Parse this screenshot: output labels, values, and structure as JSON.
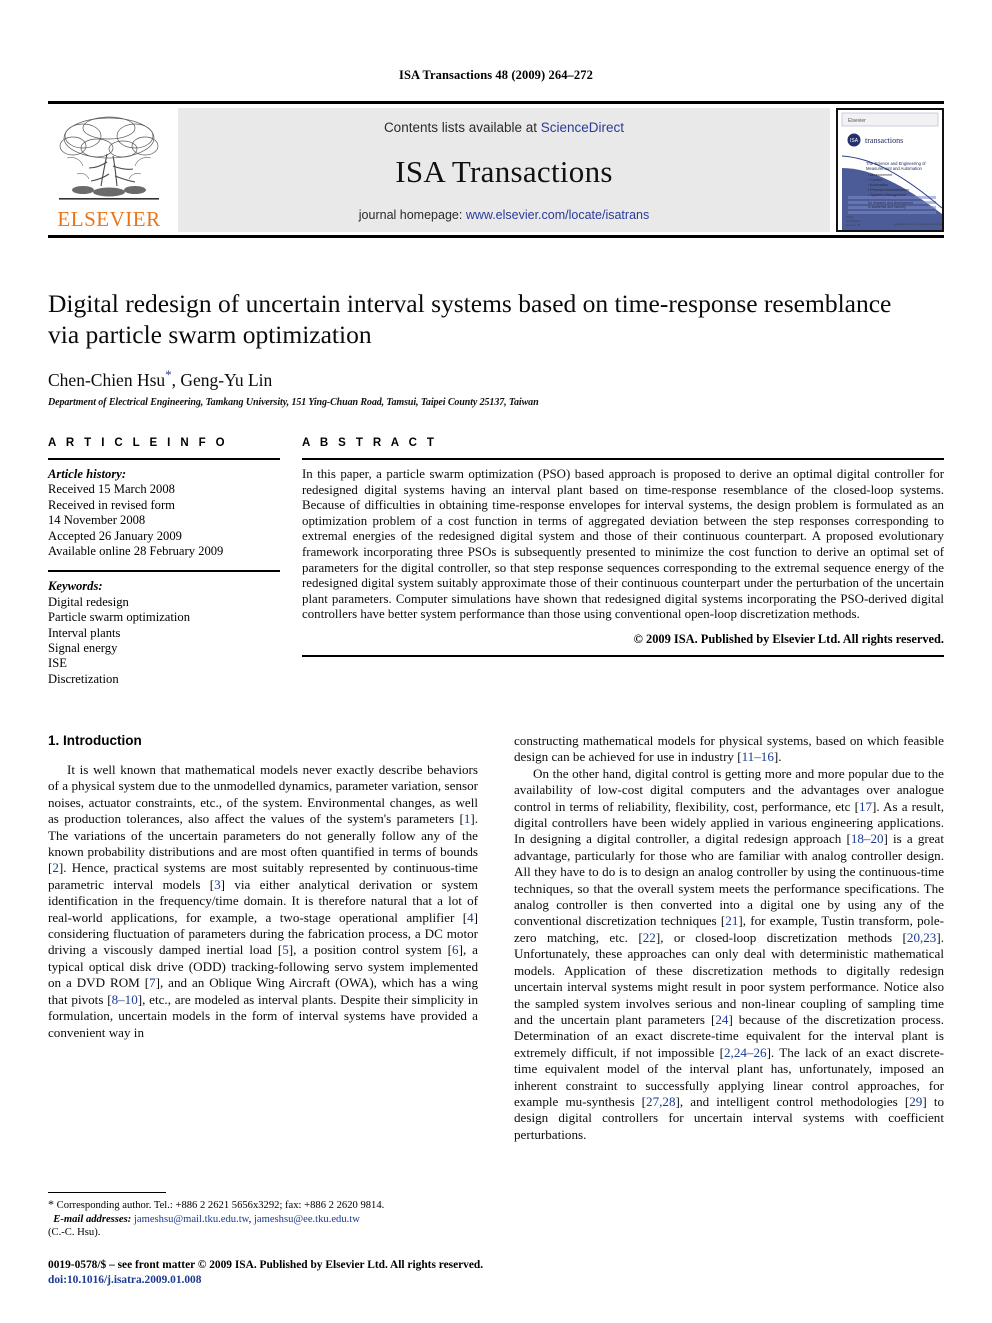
{
  "running_head": "ISA Transactions 48 (2009) 264–272",
  "masthead": {
    "publisher_name": "ELSEVIER",
    "publisher_logo_alt": "elsevier-tree-logo",
    "contents_prefix": "Contents lists available at ",
    "contents_link": "ScienceDirect",
    "journal_name": "ISA Transactions",
    "homepage_prefix": "journal homepage: ",
    "homepage_link": "www.elsevier.com/locate/isatrans",
    "cover_alt": "isa-transactions-journal-cover",
    "cover_masthead": "ISA",
    "cover_title": "transactions",
    "cover_subtitle": "The Science and Engineering of Measurement and Automation",
    "cover_bullets": [
      "Measurement",
      "Control",
      "Automation",
      "Process Instrumentation",
      "Systems Management"
    ],
    "cover_tagline": "for research and development in academia and industry"
  },
  "title": "Digital redesign of uncertain interval systems based on time-response resemblance via particle swarm optimization",
  "authors_text": "Chen-Chien Hsu",
  "authors_star": "*",
  "authors_rest": ", Geng-Yu Lin",
  "affiliation": "Department of Electrical Engineering, Tamkang University, 151 Ying-Chuan Road, Tamsui, Taipei County 25137, Taiwan",
  "article_info": {
    "heading": "A R T I C L E   I N F O",
    "history_label": "Article history:",
    "history": [
      "Received 15 March 2008",
      "Received in revised form",
      "14 November 2008",
      "Accepted 26 January 2009",
      "Available online 28 February 2009"
    ],
    "keywords_label": "Keywords:",
    "keywords": [
      "Digital redesign",
      "Particle swarm optimization",
      "Interval plants",
      "Signal energy",
      "ISE",
      "Discretization"
    ]
  },
  "abstract": {
    "heading": "A B S T R A C T",
    "body": "In this paper, a particle swarm optimization (PSO) based approach is proposed to derive an optimal digital controller for redesigned digital systems having an interval plant based on time-response resemblance of the closed-loop systems. Because of difficulties in obtaining time-response envelopes for interval systems, the design problem is formulated as an optimization problem of a cost function in terms of aggregated deviation between the step responses corresponding to extremal energies of the redesigned digital system and those of their continuous counterpart. A proposed evolutionary framework incorporating three PSOs is subsequently presented to minimize the cost function to derive an optimal set of parameters for the digital controller, so that step response sequences corresponding to the extremal sequence energy of the redesigned digital system suitably approximate those of their continuous counterpart under the perturbation of the uncertain plant parameters. Computer simulations have shown that redesigned digital systems incorporating the PSO-derived digital controllers have better system performance than those using conventional open-loop discretization methods.",
    "copyright": "© 2009 ISA. Published by Elsevier Ltd. All rights reserved."
  },
  "section": {
    "number_title": "1. Introduction"
  },
  "body_left": {
    "para1_html": "It is well known that mathematical models never exactly describe behaviors of a physical system due to the unmodelled dynamics, parameter variation, sensor noises, actuator constraints, etc., of the system. Environmental changes, as well as production tolerances, also affect the values of the system's parameters [1]. The variations of the uncertain parameters do not generally follow any of the known probability distributions and are most often quantified in terms of bounds [2]. Hence, practical systems are most suitably represented by continuous-time parametric interval models [3] via either analytical derivation or system identification in the frequency/time domain. It is therefore natural that a lot of real-world applications, for example, a two-stage operational amplifier [4] considering fluctuation of parameters during the fabrication process, a DC motor driving a viscously damped inertial load [5], a position control system [6], a typical optical disk drive (ODD) tracking-following servo system implemented on a DVD ROM [7], and an Oblique Wing Aircraft (OWA), which has a wing that pivots [8–10], etc., are modeled as interval plants. Despite their simplicity in formulation, uncertain models in the form of interval systems have provided a convenient way in"
  },
  "body_right": {
    "para_cont": "constructing mathematical models for physical systems, based on which feasible design can be achieved for use in industry [11–16].",
    "para2": "On the other hand, digital control is getting more and more popular due to the availability of low-cost digital computers and the advantages over analogue control in terms of reliability, flexibility, cost, performance, etc [17]. As a result, digital controllers have been widely applied in various engineering applications. In designing a digital controller, a digital redesign approach [18–20] is a great advantage, particularly for those who are familiar with analog controller design. All they have to do is to design an analog controller by using the continuous-time techniques, so that the overall system meets the performance specifications. The analog controller is then converted into a digital one by using any of the conventional discretization techniques [21], for example, Tustin transform, pole-zero matching, etc. [22], or closed-loop discretization methods [20,23]. Unfortunately, these approaches can only deal with deterministic mathematical models. Application of these discretization methods to digitally redesign uncertain interval systems might result in poor system performance. Notice also the sampled system involves serious and non-linear coupling of sampling time and the uncertain plant parameters [24] because of the discretization process. Determination of an exact discrete-time equivalent for the interval plant is extremely difficult, if not impossible [2,24–26]. The lack of an exact discrete-time equivalent model of the interval plant has, unfortunately, imposed an inherent constraint to successfully applying linear control approaches, for example mu-synthesis [27,28], and intelligent control methodologies [29] to design digital controllers for uncertain interval systems with coefficient perturbations."
  },
  "footnote": {
    "star": "*",
    "corresponding": "Corresponding author. Tel.: +886 2 2621 5656x3292; fax: +886 2 2620 9814.",
    "email_label": "E-mail addresses:",
    "email1": "jameshsu@mail.tku.edu.tw",
    "email2": "jameshsu@ee.tku.edu.tw",
    "email_owner": "(C.-C. Hsu)."
  },
  "footer": {
    "issn_line": "0019-0578/$ – see front matter © 2009 ISA. Published by Elsevier Ltd. All rights reserved.",
    "doi_line": "doi:10.1016/j.isatra.2009.01.008"
  },
  "colors": {
    "link_blue": "#2a3b96",
    "ref_blue": "#1b3a93",
    "elsevier_orange": "#E8751A",
    "band_gray": "#e9e9e9"
  }
}
